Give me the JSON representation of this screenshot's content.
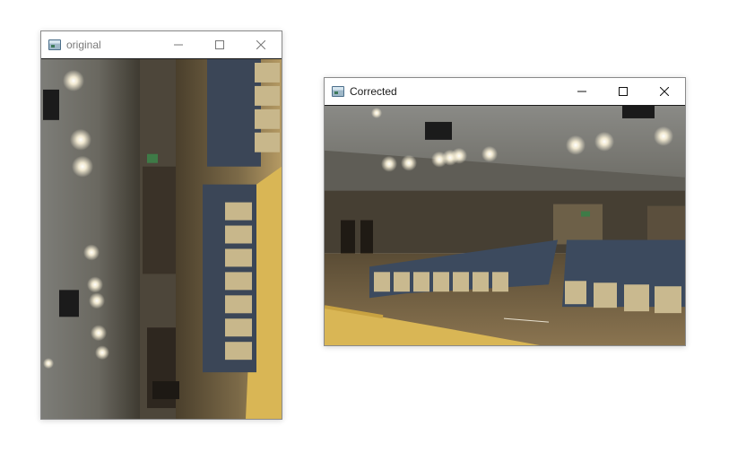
{
  "windows": {
    "original": {
      "title": "original",
      "icon": "app-window-icon",
      "controls": [
        "minimize-icon",
        "maximize-icon",
        "close-icon"
      ],
      "image": "auditorium-photo-rotated-90"
    },
    "corrected": {
      "title": "Corrected",
      "icon": "app-window-icon",
      "controls": [
        "minimize-icon",
        "maximize-icon",
        "close-icon"
      ],
      "image": "auditorium-photo-upright"
    }
  },
  "colors": {
    "title_text_original": "#7a7a7a",
    "title_text_corrected": "#1a1a1a",
    "window_border": "#8a8a8a",
    "seat_blue": "#3c4a5e",
    "seat_beige": "#c9b98f",
    "stage_wood": "#d8b85a"
  }
}
